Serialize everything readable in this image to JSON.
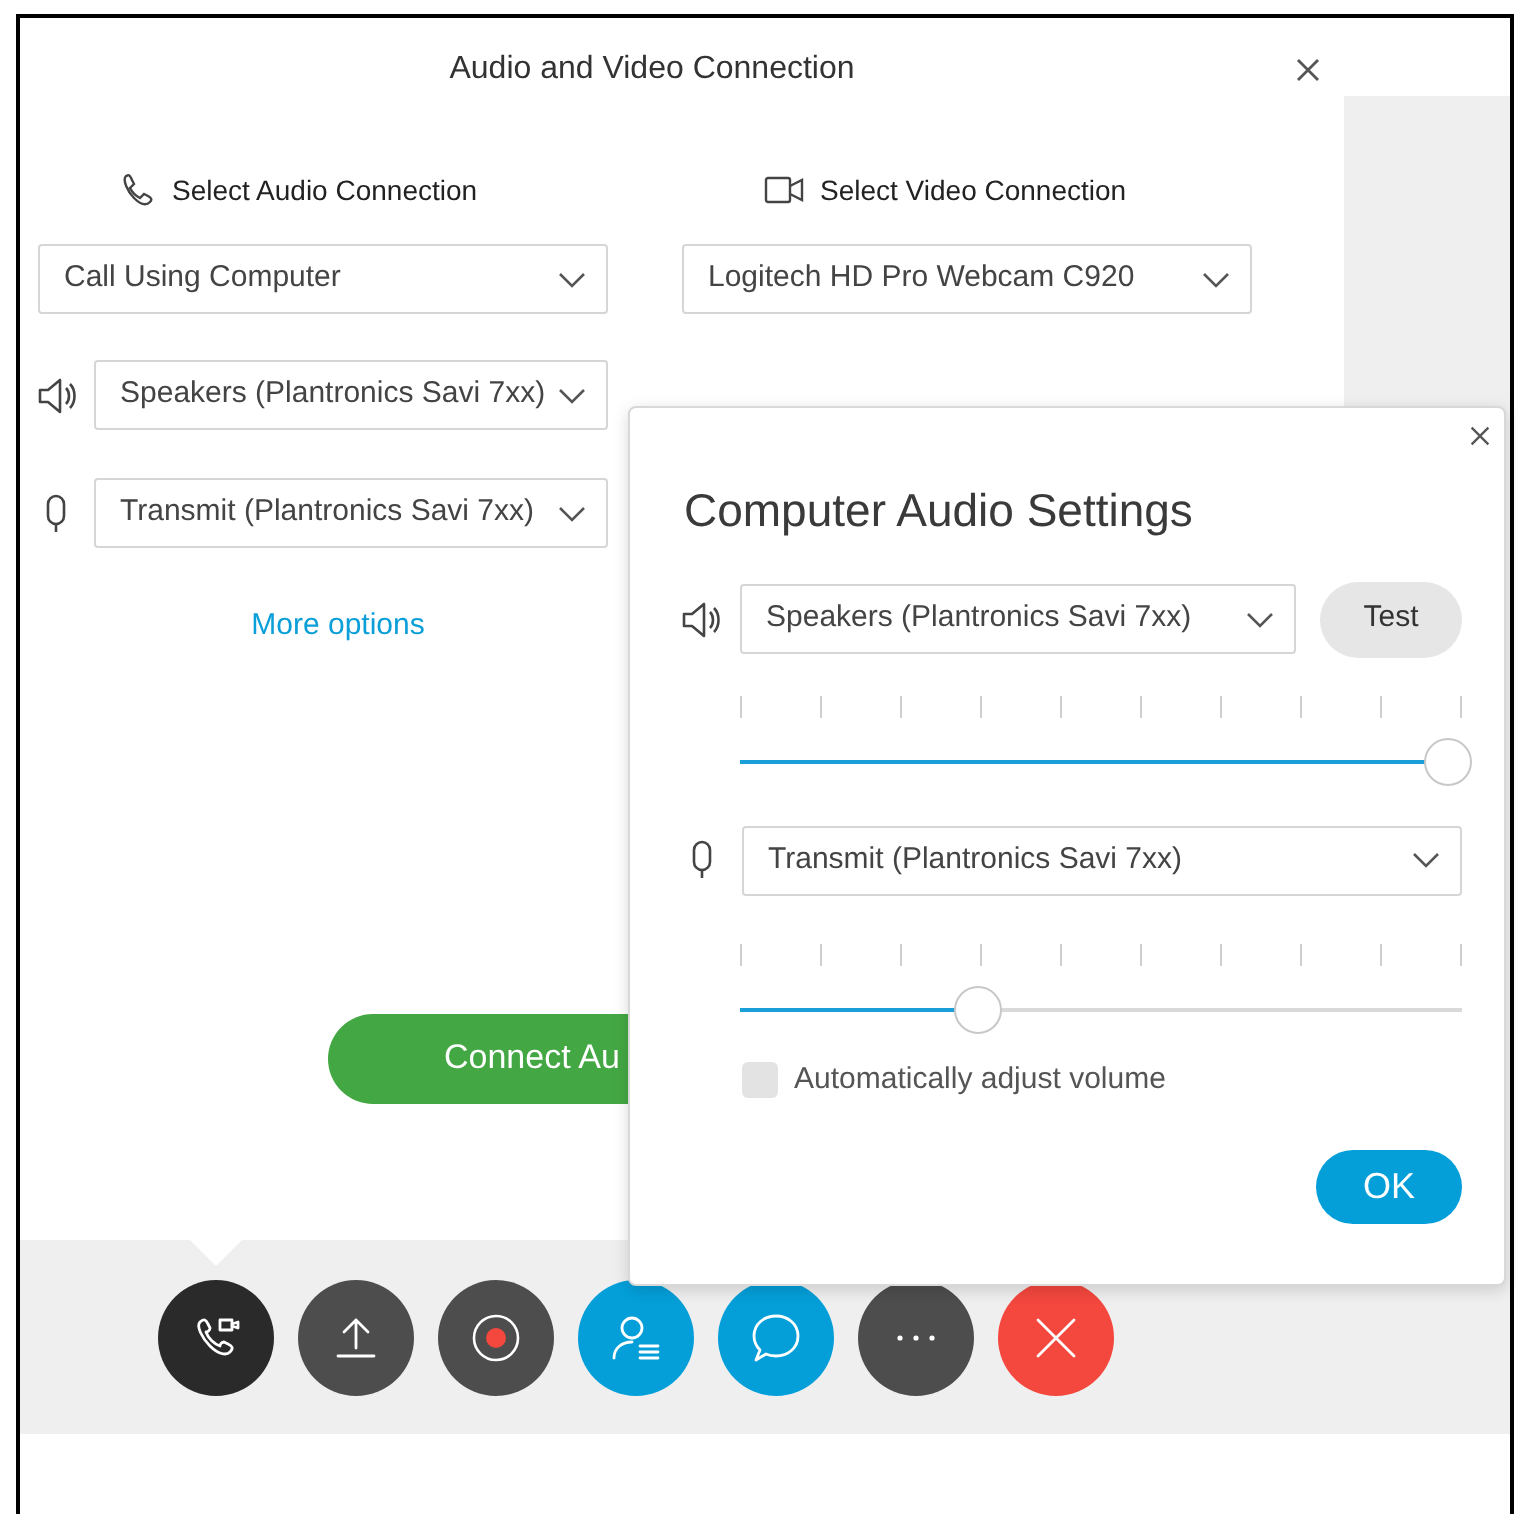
{
  "dialog": {
    "title": "Audio and Video Connection"
  },
  "audio": {
    "heading": "Select Audio Connection",
    "connection": "Call Using Computer",
    "speaker": "Speakers (Plantronics Savi 7xx)",
    "microphone": "Transmit (Plantronics Savi 7xx)",
    "more_link": "More options"
  },
  "video": {
    "heading": "Select Video Connection",
    "camera": "Logitech HD Pro Webcam C920"
  },
  "connect_button": "Connect Au",
  "audio_settings": {
    "title": "Computer Audio Settings",
    "speaker": "Speakers (Plantronics Savi 7xx)",
    "test_button": "Test",
    "speaker_volume": {
      "level": 0.98
    },
    "microphone": "Transmit (Plantronics Savi 7xx)",
    "microphone_volume": {
      "level": 0.33
    },
    "auto_adjust": {
      "label": "Automatically adjust volume",
      "checked": false
    },
    "ok_button": "OK"
  },
  "toolbar": [
    {
      "kind": "audio",
      "selected": true
    },
    {
      "kind": "share",
      "selected": false
    },
    {
      "kind": "record",
      "selected": false
    },
    {
      "kind": "participants",
      "selected": false
    },
    {
      "kind": "chat",
      "selected": false
    },
    {
      "kind": "more",
      "selected": false
    },
    {
      "kind": "leave",
      "selected": false
    }
  ]
}
